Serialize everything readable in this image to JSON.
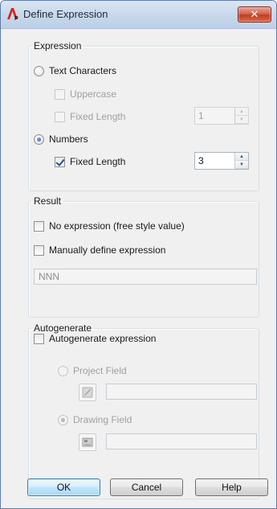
{
  "window": {
    "title": "Define Expression",
    "close_glyph": "✕"
  },
  "expression": {
    "legend": "Expression",
    "text_characters": {
      "label": "Text Characters",
      "selected": false
    },
    "uppercase": {
      "label": "Uppercase",
      "checked": false,
      "enabled": false
    },
    "text_fixed_length": {
      "label": "Fixed Length",
      "checked": false,
      "enabled": false,
      "value": "1"
    },
    "numbers": {
      "label": "Numbers",
      "selected": true
    },
    "numbers_fixed_length": {
      "label": "Fixed Length",
      "checked": true,
      "enabled": true,
      "value": "3"
    }
  },
  "result": {
    "legend": "Result",
    "no_expression": {
      "label": "No expression (free style value)",
      "checked": false
    },
    "manual_expression": {
      "label": "Manually define expression",
      "checked": false
    },
    "expression_value": "NNN"
  },
  "autogenerate": {
    "legend": "Autogenerate",
    "autogenerate_expression": {
      "label": "Autogenerate expression",
      "checked": false
    },
    "project_field": {
      "label": "Project Field",
      "selected": false,
      "enabled": false,
      "value": ""
    },
    "drawing_field": {
      "label": "Drawing Field",
      "selected": true,
      "enabled": false,
      "value": ""
    }
  },
  "buttons": {
    "ok": "OK",
    "cancel": "Cancel",
    "help": "Help"
  },
  "icons": {
    "app": "autocad-p-icon",
    "project_field_picker": "project-field-picker-icon",
    "drawing_field_picker": "drawing-field-picker-icon"
  },
  "colors": {
    "app_icon_red": "#d9261c",
    "default_button_border": "#3c7fb1",
    "close_button": "#c23e22"
  }
}
